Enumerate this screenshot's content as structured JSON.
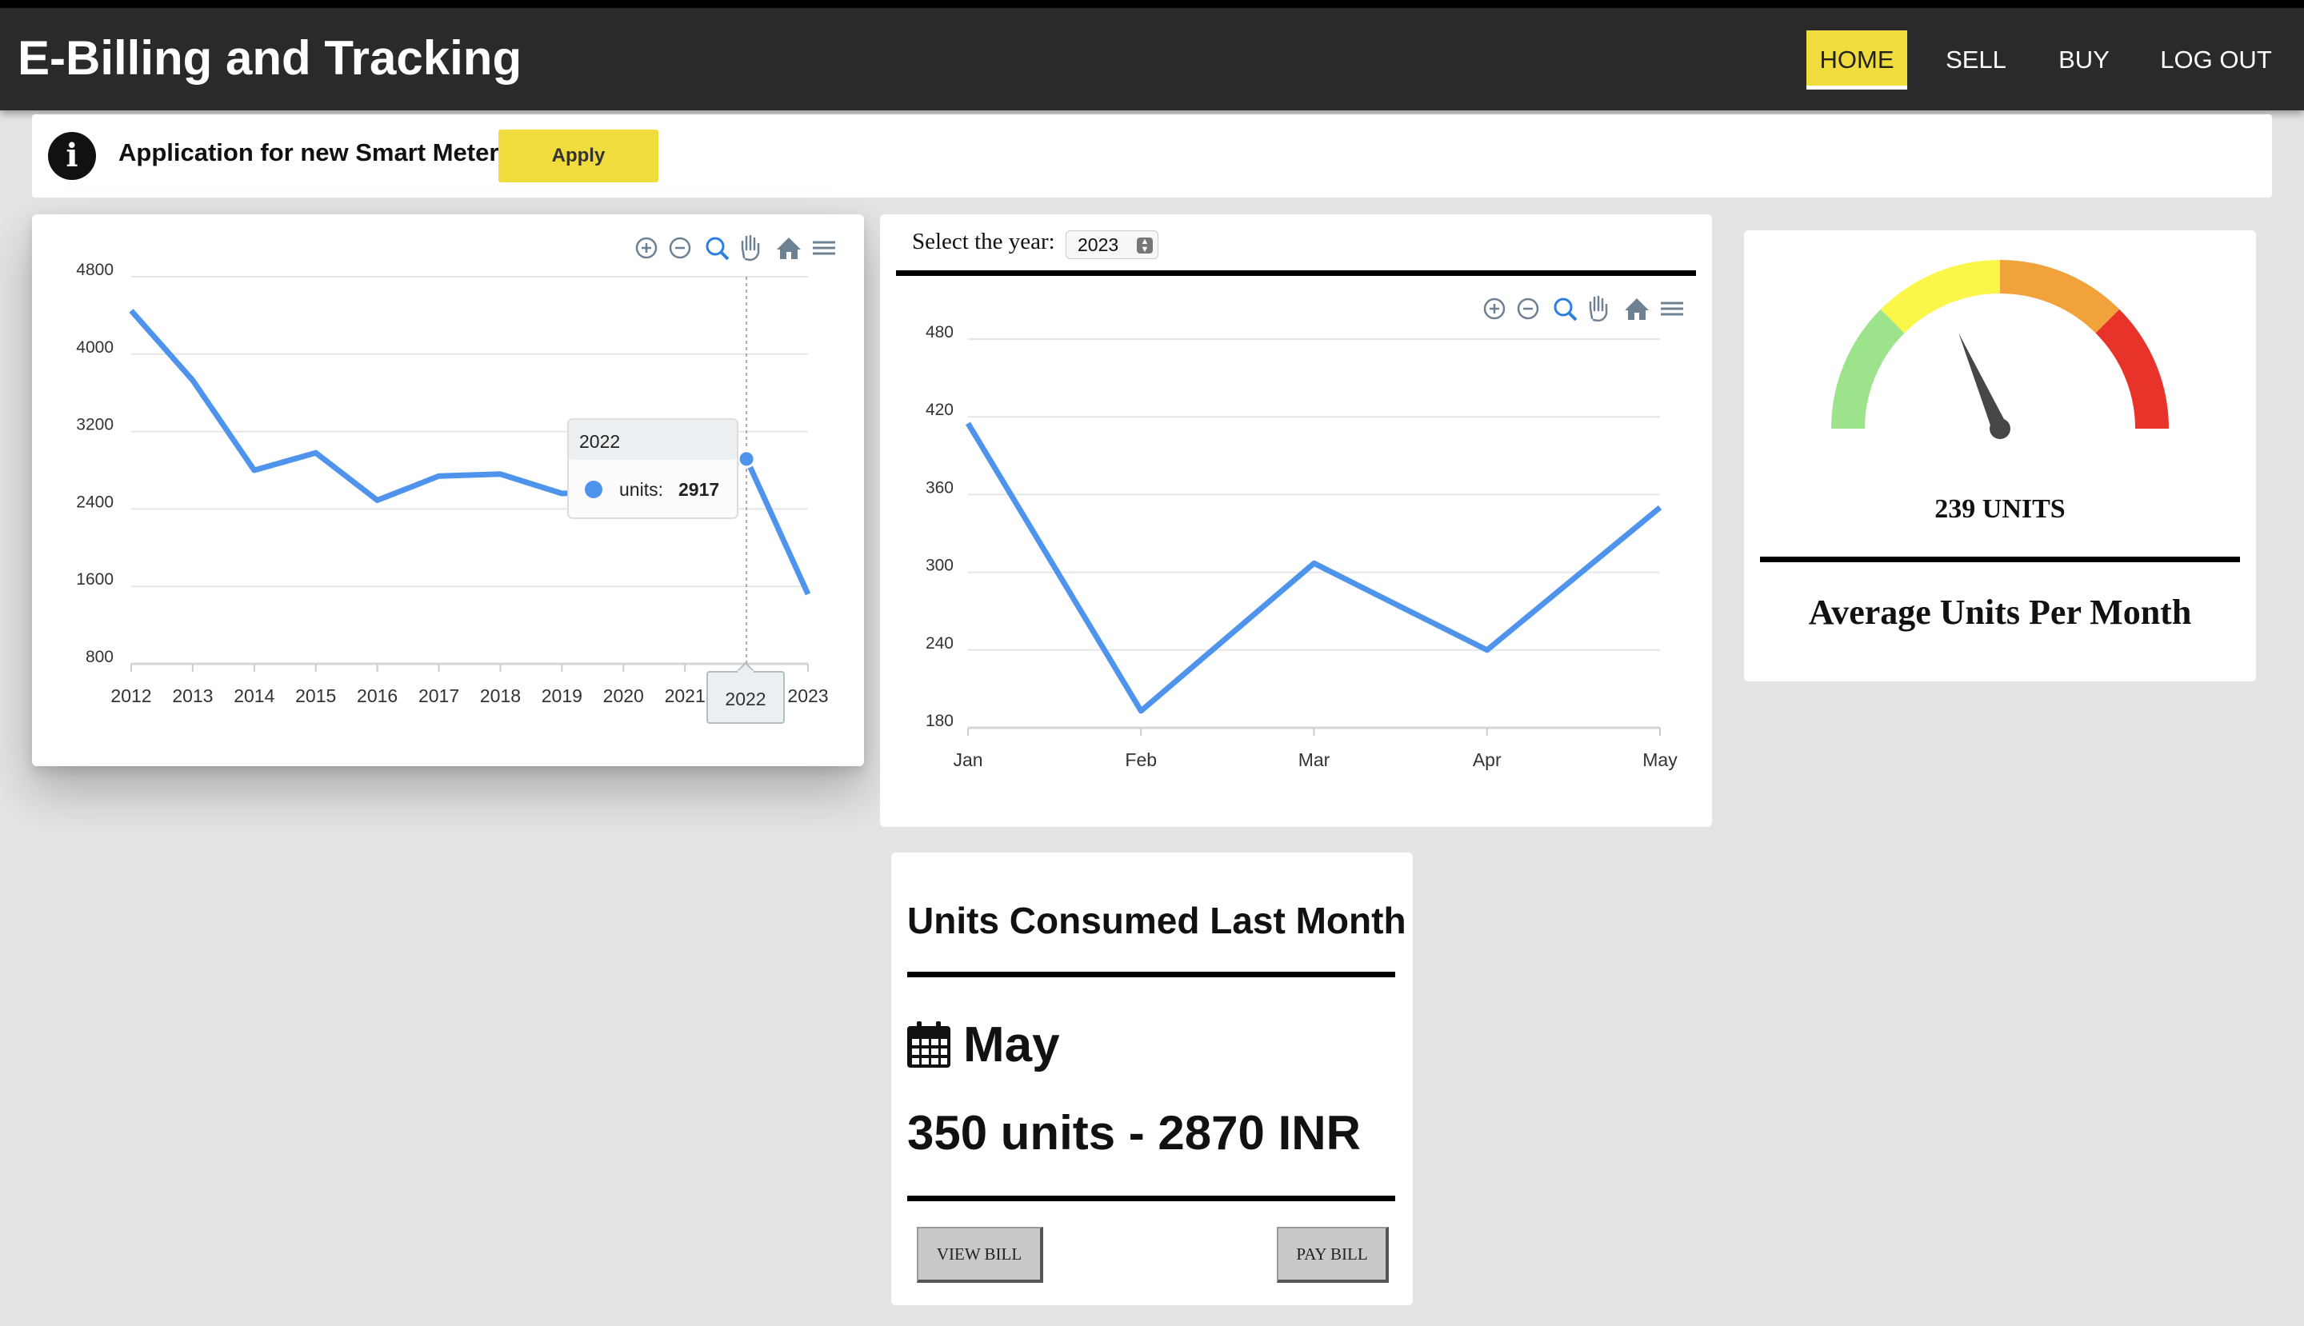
{
  "app": {
    "title": "E-Billing and Tracking"
  },
  "nav": {
    "items": [
      {
        "label": "HOME",
        "active": true
      },
      {
        "label": "SELL",
        "active": false
      },
      {
        "label": "BUY",
        "active": false
      },
      {
        "label": "LOG OUT",
        "active": false
      }
    ]
  },
  "notice": {
    "text": "Application for new Smart Meter",
    "button_label": "Apply",
    "icon": "info-icon"
  },
  "toolbar_icons": [
    "zoom-in-icon",
    "zoom-out-icon",
    "selection-zoom-icon",
    "pan-hand-icon",
    "home-reset-icon",
    "menu-icon"
  ],
  "yearly_chart": {
    "tooltip": {
      "title": "2022",
      "series_label": "units:",
      "value": "2917"
    },
    "crosshair_label": "2022"
  },
  "monthly_chart": {
    "select_label": "Select the year:",
    "selected_year": "2023"
  },
  "gauge": {
    "value_text": "239 UNITS",
    "caption": "Average Units Per Month",
    "colors": [
      "#9de38c",
      "#fbf64a",
      "#f2a23b",
      "#e7332a"
    ],
    "needle_fraction": 0.37
  },
  "last_month": {
    "title": "Units Consumed Last Month",
    "month": "May",
    "usage": "350 units - 2870 INR",
    "view_bill_label": "VIEW BILL",
    "pay_bill_label": "PAY BILL",
    "icon": "calendar-icon"
  },
  "colors": {
    "accent": "#f1dc3e",
    "line": "#4f94ec",
    "nav_bg": "#2a2a2a"
  },
  "chart_data": [
    {
      "type": "line",
      "x": [
        "2012",
        "2013",
        "2014",
        "2015",
        "2016",
        "2017",
        "2018",
        "2019",
        "2020",
        "2021",
        "2022",
        "2023"
      ],
      "series": [
        {
          "name": "units",
          "values": [
            4450,
            3730,
            2800,
            2980,
            2490,
            2740,
            2760,
            2560,
            2580,
            2700,
            2917,
            1520
          ]
        }
      ],
      "y_ticks": [
        800,
        1600,
        2400,
        3200,
        4000,
        4800
      ],
      "ylim": [
        800,
        4800
      ],
      "grid": true
    },
    {
      "type": "line",
      "x": [
        "Jan",
        "Feb",
        "Mar",
        "Apr",
        "May"
      ],
      "series": [
        {
          "values": [
            415,
            193,
            307,
            240,
            350
          ]
        }
      ],
      "y_ticks": [
        180,
        240,
        300,
        360,
        420,
        480
      ],
      "ylim": [
        180,
        480
      ],
      "grid": true
    }
  ]
}
